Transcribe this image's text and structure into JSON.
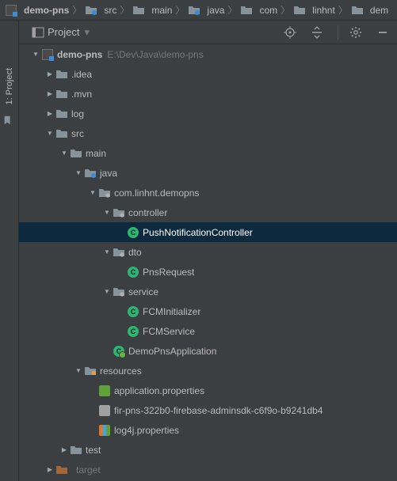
{
  "breadcrumbs": [
    {
      "label": "demo-pns",
      "icon": "project-root"
    },
    {
      "label": "src",
      "icon": "folder-blue"
    },
    {
      "label": "main",
      "icon": "folder"
    },
    {
      "label": "java",
      "icon": "folder-blue"
    },
    {
      "label": "com",
      "icon": "folder"
    },
    {
      "label": "linhnt",
      "icon": "folder"
    },
    {
      "label": "dem",
      "icon": "folder"
    }
  ],
  "tool_window": {
    "title": "Project",
    "side_label": "1: Project"
  },
  "tree": {
    "root": {
      "label": "demo-pns",
      "path": "E:\\Dev\\Java\\demo-pns"
    },
    "items": [
      {
        "depth": 0,
        "arrow": "down",
        "icon": "project-root",
        "label": "demo-pns",
        "bold": true,
        "suffix": "E:\\Dev\\Java\\demo-pns"
      },
      {
        "depth": 1,
        "arrow": "right",
        "icon": "folder",
        "label": ".idea"
      },
      {
        "depth": 1,
        "arrow": "right",
        "icon": "folder",
        "label": ".mvn"
      },
      {
        "depth": 1,
        "arrow": "right",
        "icon": "folder",
        "label": "log"
      },
      {
        "depth": 1,
        "arrow": "down",
        "icon": "folder",
        "label": "src"
      },
      {
        "depth": 2,
        "arrow": "down",
        "icon": "folder",
        "label": "main"
      },
      {
        "depth": 3,
        "arrow": "down",
        "icon": "folder-blue",
        "label": "java"
      },
      {
        "depth": 4,
        "arrow": "down",
        "icon": "package",
        "label": "com.linhnt.demopns"
      },
      {
        "depth": 5,
        "arrow": "down",
        "icon": "package",
        "label": "controller"
      },
      {
        "depth": 6,
        "arrow": "",
        "icon": "class",
        "label": "PushNotificationController",
        "selected": true
      },
      {
        "depth": 5,
        "arrow": "down",
        "icon": "package",
        "label": "dto"
      },
      {
        "depth": 6,
        "arrow": "",
        "icon": "class",
        "label": "PnsRequest"
      },
      {
        "depth": 5,
        "arrow": "down",
        "icon": "package",
        "label": "service"
      },
      {
        "depth": 6,
        "arrow": "",
        "icon": "class",
        "label": "FCMInitializer"
      },
      {
        "depth": 6,
        "arrow": "",
        "icon": "class",
        "label": "FCMService"
      },
      {
        "depth": 5,
        "arrow": "",
        "icon": "spring",
        "label": "DemoPnsApplication"
      },
      {
        "depth": 3,
        "arrow": "down",
        "icon": "folder-res",
        "label": "resources"
      },
      {
        "depth": 4,
        "arrow": "",
        "icon": "leaf",
        "label": "application.properties"
      },
      {
        "depth": 4,
        "arrow": "",
        "icon": "file",
        "label": "fir-pns-322b0-firebase-adminsdk-c6f9o-b9241db4"
      },
      {
        "depth": 4,
        "arrow": "",
        "icon": "log",
        "label": "log4j.properties"
      },
      {
        "depth": 2,
        "arrow": "right",
        "icon": "folder",
        "label": "test"
      },
      {
        "depth": 1,
        "arrow": "right",
        "icon": "folder-orange",
        "label": "target",
        "dim": true
      }
    ]
  }
}
